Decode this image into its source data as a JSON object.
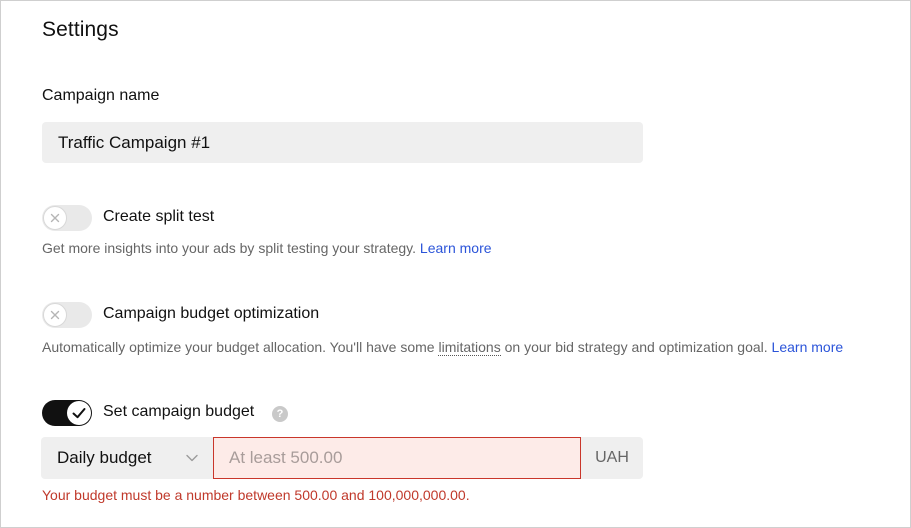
{
  "settings": {
    "title": "Settings",
    "campaign_name": {
      "label": "Campaign name",
      "value": "Traffic Campaign #1"
    },
    "split_test": {
      "label": "Create split test",
      "enabled": false,
      "helper_text": "Get more insights into your ads by split testing your strategy.",
      "learn_more": "Learn more"
    },
    "budget_optimization": {
      "label": "Campaign budget optimization",
      "enabled": false,
      "helper_text_before": "Automatically optimize your budget allocation. You'll have some",
      "helper_link_limitations": "limitations",
      "helper_text_after": "on your bid strategy and optimization goal.",
      "learn_more": "Learn more"
    },
    "set_budget": {
      "label": "Set campaign budget",
      "enabled": true,
      "help_icon": "question-circle-icon",
      "budget_type": "Daily budget",
      "amount_value": "",
      "amount_placeholder": "At least 500.00",
      "currency": "UAH",
      "error_text": "Your budget must be a number between 500.00 and 100,000,000.00."
    }
  },
  "colors": {
    "link": "#2b54d9",
    "error": "#c0392b",
    "error_bg": "#fdebe8",
    "toggle_on": "#111111",
    "toggle_off": "#e9e9e9",
    "input_bg": "#efefef"
  }
}
